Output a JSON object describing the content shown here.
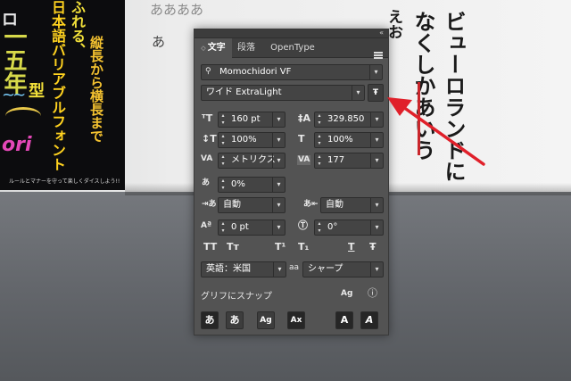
{
  "background": {
    "poster_lines": [
      "一五年",
      "ふれる、",
      "縦長から横長まで",
      "日本語バリアブルフォント",
      "ルールとマナーを守って楽しくダイスしよう!!"
    ],
    "poster_cut": "ロ",
    "poster_wave": "~~",
    "poster_ori": "ori",
    "poster_mid": "型",
    "top_text": "ああああ",
    "mid_text": "あ",
    "vertical_1": "ビューロランドに",
    "vertical_2": "なくしかあいう",
    "vertical_3": "えお"
  },
  "panel": {
    "collapse_icon": "«",
    "tabs": [
      {
        "label": "文字",
        "active": true
      },
      {
        "label": "段落",
        "active": false
      },
      {
        "label": "OpenType",
        "active": false
      }
    ],
    "font_family": "Momochidori VF",
    "font_style": "ワイド ExtraLight",
    "font_size": "160 pt",
    "leading": "329.850",
    "vertical_scale": "100%",
    "horizontal_scale": "100%",
    "kerning": "メトリクス",
    "tracking": "177",
    "tsume": "0%",
    "aki_left": "自動",
    "aki_right": "自動",
    "baseline_shift": "0 pt",
    "rotation": "0°",
    "style_buttons": [
      "TT",
      "Tт",
      "T¹",
      "T₁",
      "T",
      "Ŧ"
    ],
    "language": "英語：米国",
    "aa_label": "aa",
    "anti_alias": "シャープ",
    "snap_label": "グリフにスナップ",
    "snap_buttons": [
      "あ",
      "あ",
      "Ag",
      "Ax",
      "A",
      "A"
    ]
  }
}
